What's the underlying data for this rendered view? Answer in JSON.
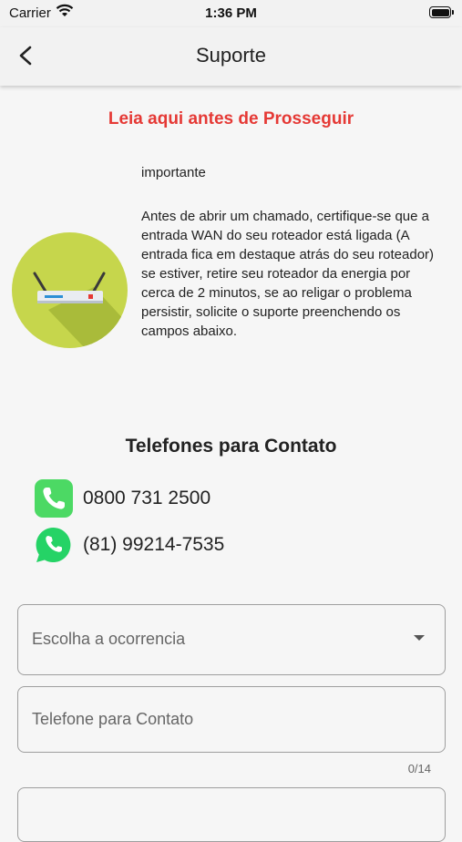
{
  "status": {
    "carrier": "Carrier",
    "time": "1:36 PM"
  },
  "app_bar": {
    "title": "Suporte"
  },
  "notice": {
    "title": "Leia aqui antes de Prosseguir",
    "label": "importante",
    "body": "Antes de abrir um chamado, certifique-se que a entrada WAN do seu roteador está ligada (A entrada fica em destaque atrás do seu roteador) se estiver, retire seu roteador da energia por cerca de 2 minutos, se ao religar o problema persistir, solicite o suporte preenchendo os campos abaixo."
  },
  "contacts": {
    "title": "Telefones para Contato",
    "items": [
      {
        "icon": "phone-icon",
        "number": "0800 731 2500"
      },
      {
        "icon": "whatsapp-icon",
        "number": "(81) 99214-7535"
      }
    ]
  },
  "form": {
    "occurrence_placeholder": "Escolha a ocorrencia",
    "phone_placeholder": "Telefone para Contato",
    "phone_counter": "0/14"
  },
  "colors": {
    "accent_red": "#e53935",
    "router_circle": "#c6d64c",
    "phone_green": "#4cd964",
    "whatsapp_green": "#25d366"
  }
}
